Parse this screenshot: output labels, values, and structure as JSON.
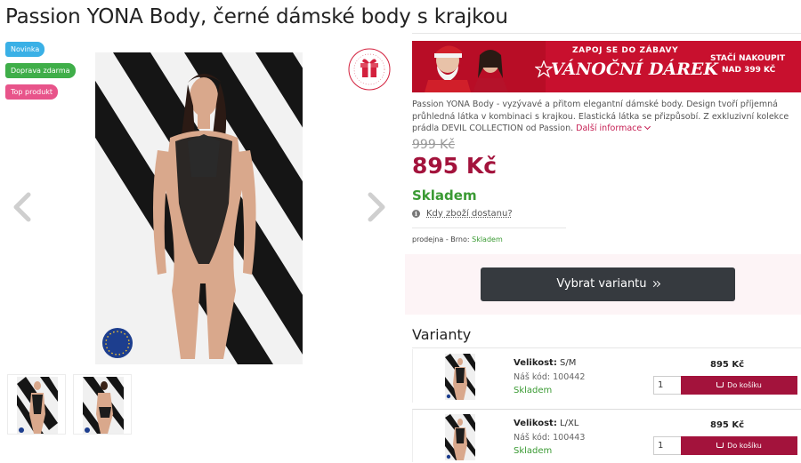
{
  "product": {
    "title": "Passion YONA Body, černé dámské body s krajkou",
    "badges": {
      "new": "Novinka",
      "free_shipping": "Doprava zdarma",
      "top": "Top produkt"
    },
    "gift_stamp_text": "tip na dárek | tip na dárek |",
    "made_in_europe_badge": "MADE IN EUROPE",
    "description": "Passion YONA Body - vyzývavé a přitom elegantní dámské body. Design tvoří příjemná průhledná látka v kombinaci s krajkou. Elastická látka se přizpůsobí. Z exkluzivní kolekce prádla DEVIL COLLECTION od Passion.",
    "more_info": "Další informace",
    "old_price": "999 Kč",
    "price": "895 Kč",
    "stock": "Skladem",
    "delivery_question": "Kdy zboží dostanu?",
    "store_label": "prodejna - Brno:",
    "store_status": "Skladem",
    "choose_variant": "Vybrat variantu"
  },
  "promo": {
    "line1": "ZAPOJ SE DO ZÁBAVY",
    "line2": "VÁNOČNÍ DÁREK",
    "right1": "STAČÍ NAKOUPIT",
    "right2": "NAD 399 KČ"
  },
  "variants": {
    "title": "Varianty",
    "items": [
      {
        "size_label": "Velikost:",
        "size": "S/M",
        "code": "Náš kód: 100442",
        "stock": "Skladem",
        "price": "895 Kč",
        "qty": "1",
        "cart": "Do košíku"
      },
      {
        "size_label": "Velikost:",
        "size": "L/XL",
        "code": "Náš kód: 100443",
        "stock": "Skladem",
        "price": "895 Kč",
        "qty": "1",
        "cart": "Do košíku"
      }
    ]
  },
  "colors": {
    "accent": "#a3133c",
    "stock_green": "#3a9a33",
    "badge_blue": "#3ab0e6",
    "badge_green": "#3fae49",
    "badge_pink": "#e8548a",
    "promo_red": "#c8102e",
    "button_dark": "#363a3f"
  },
  "icons": [
    "chevron-left-icon",
    "chevron-right-icon",
    "gift-icon",
    "info-icon",
    "chevron-down-icon",
    "double-chevron-right-icon",
    "basket-icon"
  ]
}
